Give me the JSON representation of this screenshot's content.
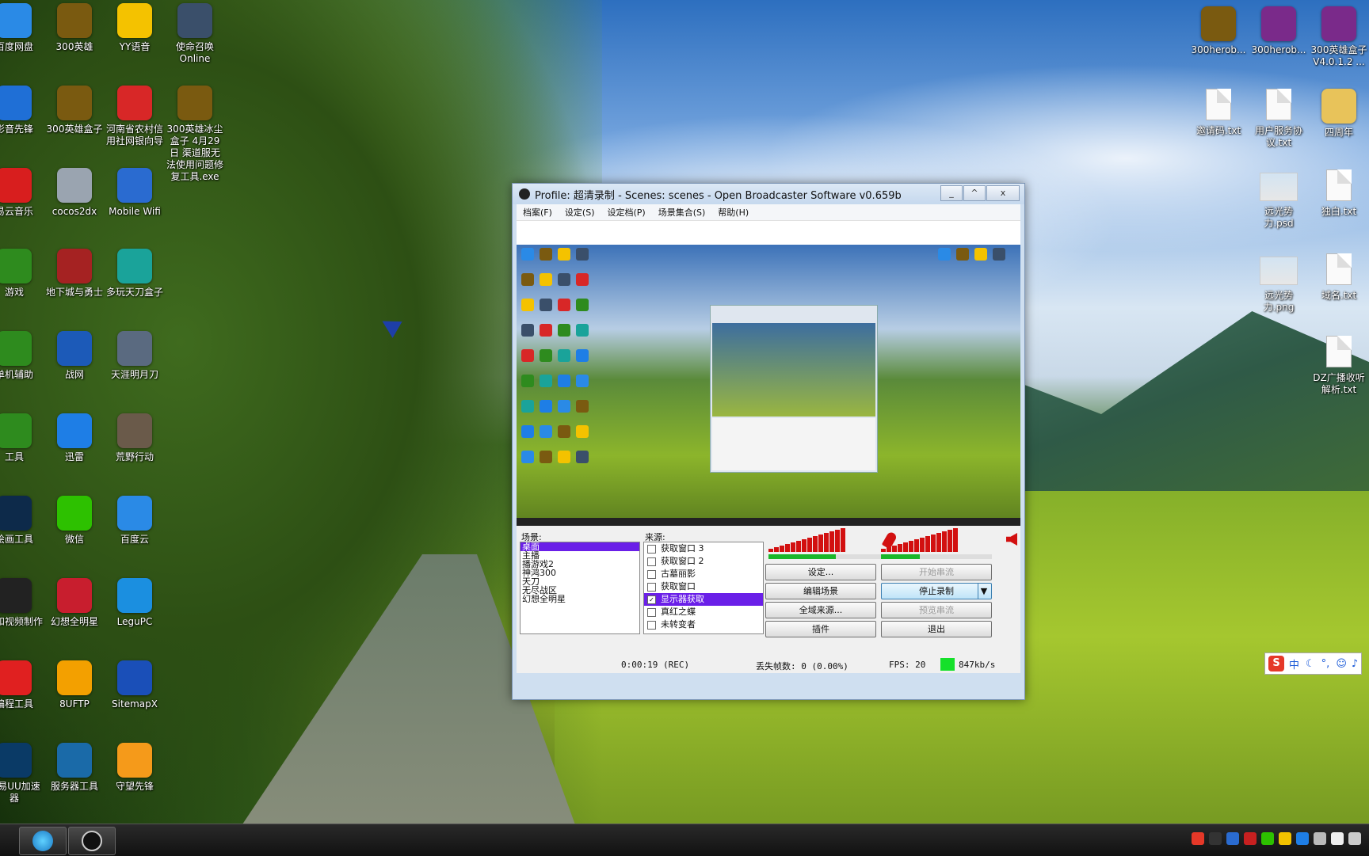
{
  "desktop_left": [
    {
      "label": "百度网盘",
      "icon": "baidu-netdisk-icon",
      "color": "#2a8ae6"
    },
    {
      "label": "300英雄",
      "icon": "300hero-icon",
      "color": "#7a5a10"
    },
    {
      "label": "YY语音",
      "icon": "yy-voice-icon",
      "color": "#f4c200"
    },
    {
      "label": "使命召唤 Online",
      "icon": "cod-online-icon",
      "color": "#3a4f6a"
    },
    {
      "label": "影音先锋",
      "icon": "xfplay-icon",
      "color": "#1f6fd6"
    },
    {
      "label": "300英雄盒子",
      "icon": "300hero-box-icon",
      "color": "#7a5a10"
    },
    {
      "label": "河南省农村信用社网银向导",
      "icon": "bank-guide-icon",
      "color": "#d82727"
    },
    {
      "label": "300英雄冰尘盒子 4月29日 渠道服无法使用问题修复工具.exe",
      "icon": "300hero-fix-icon",
      "color": "#7a5a10"
    },
    {
      "label": "易云音乐",
      "icon": "netease-music-icon",
      "color": "#d81e1e"
    },
    {
      "label": "cocos2dx",
      "icon": "cocos2dx-icon",
      "color": "#9aa4b0"
    },
    {
      "label": "Mobile Wifi",
      "icon": "mobile-wifi-icon",
      "color": "#2a6bd0"
    },
    {
      "label": "游戏",
      "icon": "tree-folder-icon",
      "color": "#2e8b1e"
    },
    {
      "label": "地下城与勇士",
      "icon": "dnf-icon",
      "color": "#a52222"
    },
    {
      "label": "多玩天刀盒子",
      "icon": "tiandao-box-icon",
      "color": "#1aa39a"
    },
    {
      "label": "单机辅助",
      "icon": "tree-folder-icon",
      "color": "#2e8b1e"
    },
    {
      "label": "战网",
      "icon": "battlenet-icon",
      "color": "#1c5ab8"
    },
    {
      "label": "天涯明月刀",
      "icon": "tianya-icon",
      "color": "#5a6a80"
    },
    {
      "label": "工具",
      "icon": "tree-folder-icon",
      "color": "#2e8b1e"
    },
    {
      "label": "迅雷",
      "icon": "thunder-icon",
      "color": "#1e7ee6"
    },
    {
      "label": "荒野行动",
      "icon": "knives-out-icon",
      "color": "#6a5a4a"
    },
    {
      "label": "绘画工具",
      "icon": "photoshop-icon",
      "color": "#0d2a4a"
    },
    {
      "label": "微信",
      "icon": "wechat-icon",
      "color": "#2dc100"
    },
    {
      "label": "百度云",
      "icon": "baidu-cloud-icon",
      "color": "#2a8ae6"
    },
    {
      "label": "音和视频制作",
      "icon": "obs-icon",
      "color": "#222222"
    },
    {
      "label": "幻想全明星",
      "icon": "fantasy-allstar-icon",
      "color": "#c81e2e"
    },
    {
      "label": "LeguPC",
      "icon": "legupc-icon",
      "color": "#1b8fe0"
    },
    {
      "label": "编程工具",
      "icon": "hbuilder-icon",
      "color": "#e02020"
    },
    {
      "label": "8UFTP",
      "icon": "ftp-icon",
      "color": "#f3a000"
    },
    {
      "label": "SitemapX",
      "icon": "sitemapx-icon",
      "color": "#1a4fb8"
    },
    {
      "label": "网易UU加速器",
      "icon": "uu-accelerator-icon",
      "color": "#0a3a66"
    },
    {
      "label": "服务器工具",
      "icon": "server-tool-icon",
      "color": "#1a6aa8"
    },
    {
      "label": "守望先锋",
      "icon": "overwatch-icon",
      "color": "#f59a1a"
    }
  ],
  "desktop_right": [
    {
      "label": "300herob...",
      "icon": "300hero-icon",
      "type": "app"
    },
    {
      "label": "300herob...",
      "icon": "winrar-icon",
      "type": "app"
    },
    {
      "label": "300英雄盒子V4.0.1.2 ...",
      "icon": "winrar-icon",
      "type": "app"
    },
    {
      "label": "邀请码.txt",
      "icon": "text-file-icon",
      "type": "file"
    },
    {
      "label": "用户服务协议.txt",
      "icon": "text-file-icon",
      "type": "file"
    },
    {
      "label": "四周年",
      "icon": "folder-icon",
      "type": "folder"
    },
    {
      "label": "远光势力.psd",
      "icon": "psd-file-icon",
      "type": "image"
    },
    {
      "label": "独白.txt",
      "icon": "text-file-icon",
      "type": "file"
    },
    {
      "label": "远光势力.png",
      "icon": "png-file-icon",
      "type": "image"
    },
    {
      "label": "域名.txt",
      "icon": "text-file-icon",
      "type": "file"
    },
    {
      "label": "DZ广播收听解析.txt",
      "icon": "text-file-icon",
      "type": "file"
    }
  ],
  "obs": {
    "title": "Profile: 超清录制 - Scenes: scenes - Open Broadcaster Software v0.659b",
    "menu": [
      "档案(F)",
      "设定(S)",
      "设定档(P)",
      "场景集合(S)",
      "帮助(H)"
    ],
    "scenes_label": "场景:",
    "scenes": [
      "桌面",
      "主播",
      "播游戏2",
      "神鸿300",
      "天刀",
      "无尽战区",
      "幻想全明星"
    ],
    "sources_label": "来源:",
    "sources": [
      {
        "label": "获取窗口 3",
        "checked": false
      },
      {
        "label": "获取窗口 2",
        "checked": false
      },
      {
        "label": "古墓丽影",
        "checked": false
      },
      {
        "label": "获取窗口",
        "checked": false
      },
      {
        "label": "显示器获取",
        "checked": true
      },
      {
        "label": "真红之蝶",
        "checked": false
      },
      {
        "label": "未转变者",
        "checked": false
      }
    ],
    "buttons": {
      "settings": "设定...",
      "start_streaming": "开始串流",
      "edit_scene": "编辑场景",
      "stop_recording": "停止录制",
      "global_sources": "全域来源...",
      "preview_stream": "预览串流",
      "plugins": "插件",
      "exit": "退出"
    },
    "status": {
      "time": "0:00:19 (REC)",
      "dropped_frames": "丢失帧数: 0 (0.00%)",
      "fps": "FPS: 20",
      "bitrate": "847kb/s"
    },
    "mic_level": 0.6,
    "desktop_level": 0.35
  },
  "ime": {
    "label": "中"
  },
  "taskbar": {
    "items": [
      "360-browser-icon",
      "obs-icon"
    ]
  }
}
